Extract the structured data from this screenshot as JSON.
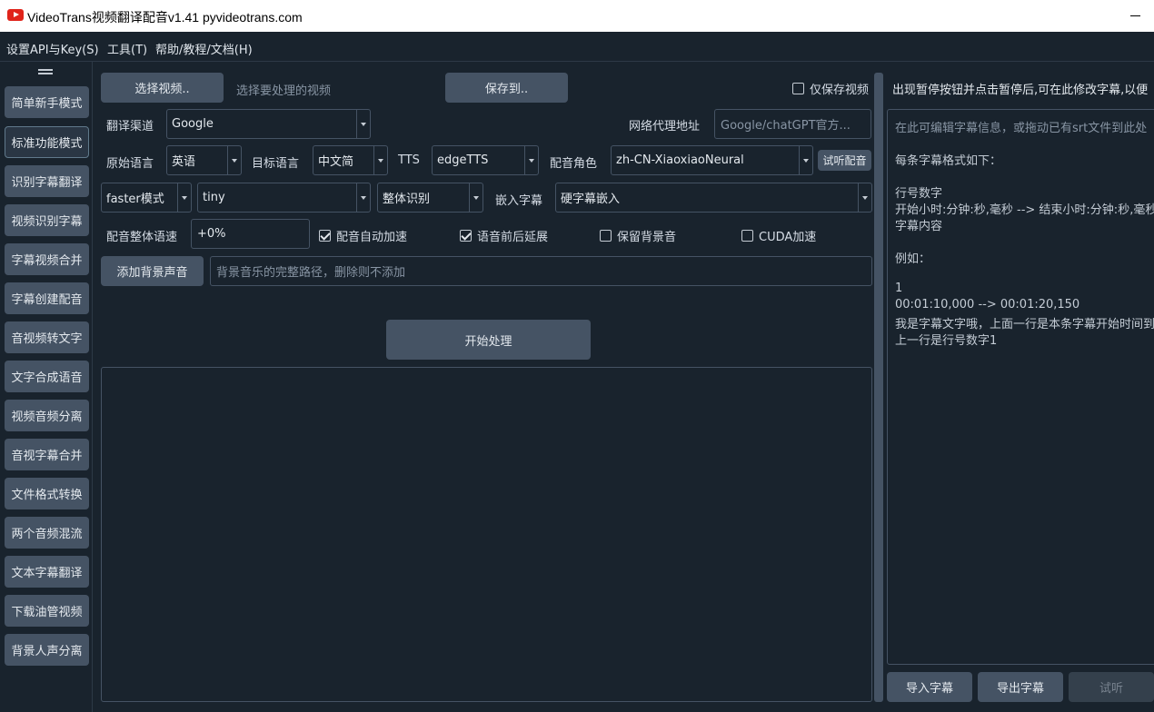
{
  "window": {
    "title": "VideoTrans视频翻译配音v1.41  pyvideotrans.com"
  },
  "menu": [
    "设置API与Key(S)",
    "工具(T)",
    "帮助/教程/文档(H)"
  ],
  "sidebar": {
    "items": [
      {
        "label": "简单新手模式"
      },
      {
        "label": "标准功能模式",
        "active": true
      },
      {
        "label": "识别字幕翻译"
      },
      {
        "label": "视频识别字幕"
      },
      {
        "label": "字幕视频合并"
      },
      {
        "label": "字幕创建配音"
      },
      {
        "label": "音视频转文字"
      },
      {
        "label": "文字合成语音"
      },
      {
        "label": "视频音频分离"
      },
      {
        "label": "音视字幕合并"
      },
      {
        "label": "文件格式转换"
      },
      {
        "label": "两个音频混流"
      },
      {
        "label": "文本字幕翻译"
      },
      {
        "label": "下载油管视频"
      },
      {
        "label": "背景人声分离"
      }
    ]
  },
  "main": {
    "select_video_button": "选择视频..",
    "select_video_hint": "选择要处理的视频",
    "save_to_button": "保存到..",
    "only_save_video": {
      "label": "仅保存视频",
      "checked": false
    },
    "translate_channel_label": "翻译渠道",
    "translate_channel_value": "Google",
    "proxy_label": "网络代理地址",
    "proxy_placeholder": "Google/chatGPT官方...",
    "source_lang_label": "原始语言",
    "source_lang_value": "英语",
    "target_lang_label": "目标语言",
    "target_lang_value": "中文简",
    "tts_label": "TTS",
    "tts_value": "edgeTTS",
    "voice_role_label": "配音角色",
    "voice_role_value": "zh-CN-XiaoxiaoNeural",
    "listen_button": "试听配音",
    "whisper_mode_value": "faster模式",
    "model_value": "tiny",
    "recognize_mode_value": "整体识别",
    "embed_subtitle_label": "嵌入字幕",
    "embed_subtitle_value": "硬字幕嵌入",
    "speed_label": "配音整体语速",
    "speed_value": "+0%",
    "auto_accelerate": {
      "label": "配音自动加速",
      "checked": true
    },
    "voice_extend": {
      "label": "语音前后延展",
      "checked": true
    },
    "keep_bgm": {
      "label": "保留背景音",
      "checked": false
    },
    "cuda": {
      "label": "CUDA加速",
      "checked": false
    },
    "add_bgm_button": "添加背景声音",
    "bgm_path_placeholder": "背景音乐的完整路径，删除则不添加",
    "start_button": "开始处理"
  },
  "right": {
    "top_hint": "出现暂停按钮并点击暂停后,可在此修改字幕,以便",
    "editor_lines": [
      "在此可编辑字幕信息，或拖动已有srt文件到此处",
      "",
      "每条字幕格式如下：",
      "",
      "行号数字",
      "开始小时:分钟:秒,毫秒 --> 结束小时:分钟:秒,毫秒",
      "字幕内容",
      "",
      "例如：",
      "",
      "1",
      "00:01:10,000 --> 00:01:20,150",
      "我是字幕文字哦，上面一行是本条字幕开始时间到结束时间",
      "上一行是行号数字1"
    ],
    "import_button": "导入字幕",
    "export_button": "导出字幕",
    "listen_button": "试听"
  }
}
